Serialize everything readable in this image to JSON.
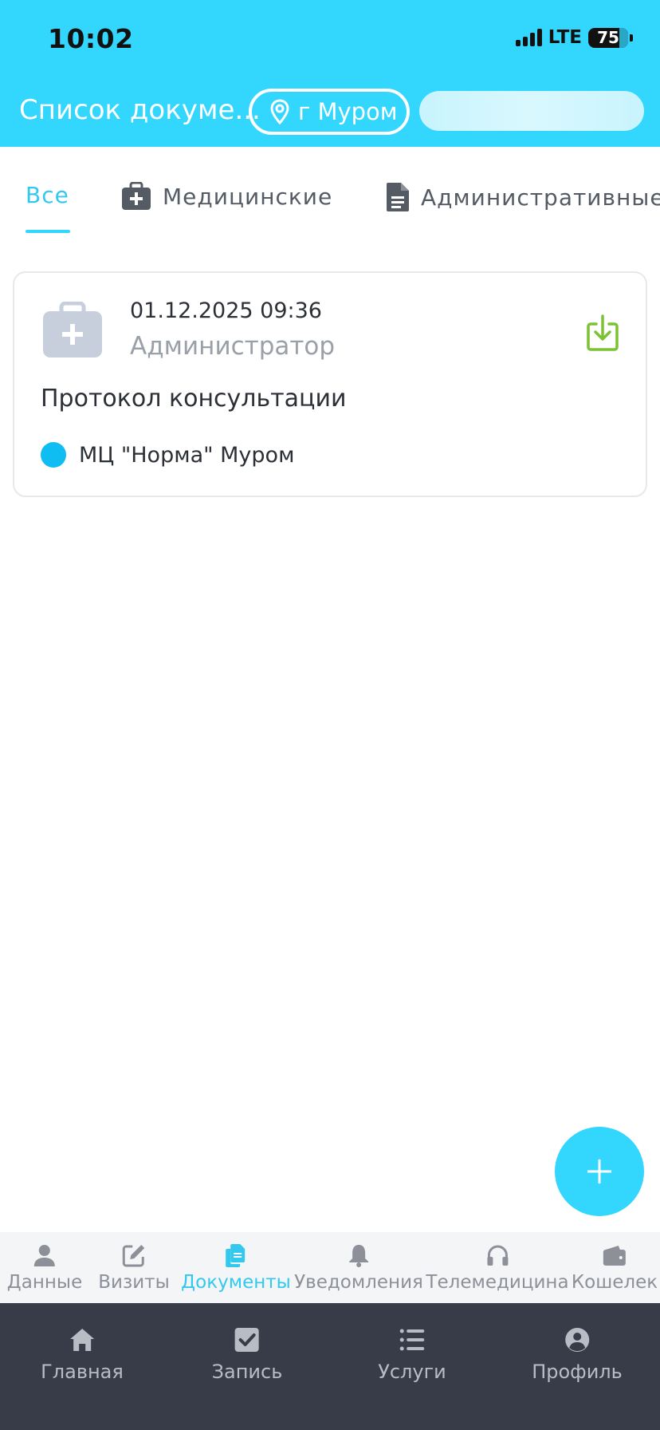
{
  "status_bar": {
    "time": "10:02",
    "network": "LTE",
    "battery": "75"
  },
  "header": {
    "title": "Список докуме...",
    "city": "г Муром"
  },
  "tabs": [
    {
      "label": "Все",
      "icon": "none",
      "active": true
    },
    {
      "label": "Медицинские",
      "icon": "medical-case-icon",
      "active": false
    },
    {
      "label": "Административные",
      "icon": "document-icon",
      "active": false
    }
  ],
  "documents": [
    {
      "datetime": "01.12.2025 09:36",
      "author": "Администратор",
      "title": "Протокол консультации",
      "clinic": "МЦ \"Норма\" Муром",
      "clinic_color": "#0fbdf3",
      "icon": "medical-case-icon",
      "action_icon": "download-icon"
    }
  ],
  "fab": {
    "icon": "plus-icon"
  },
  "section_nav": [
    {
      "label": "Данные",
      "icon": "person-icon",
      "active": false
    },
    {
      "label": "Визиты",
      "icon": "edit-icon",
      "active": false
    },
    {
      "label": "Документы",
      "icon": "documents-icon",
      "active": true
    },
    {
      "label": "Уведомления",
      "icon": "bell-icon",
      "active": false
    },
    {
      "label": "Телемедицина",
      "icon": "headphones-icon",
      "active": false
    },
    {
      "label": "Кошелек",
      "icon": "wallet-icon",
      "active": false
    }
  ],
  "bottom_nav": [
    {
      "label": "Главная",
      "icon": "home-icon"
    },
    {
      "label": "Запись",
      "icon": "checkbox-icon"
    },
    {
      "label": "Услуги",
      "icon": "list-icon"
    },
    {
      "label": "Профиль",
      "icon": "profile-icon"
    }
  ],
  "colors": {
    "accent": "#33d6fd",
    "active_text": "#33c9ef",
    "download": "#7cc232",
    "bottom_nav_bg": "#383c48"
  }
}
